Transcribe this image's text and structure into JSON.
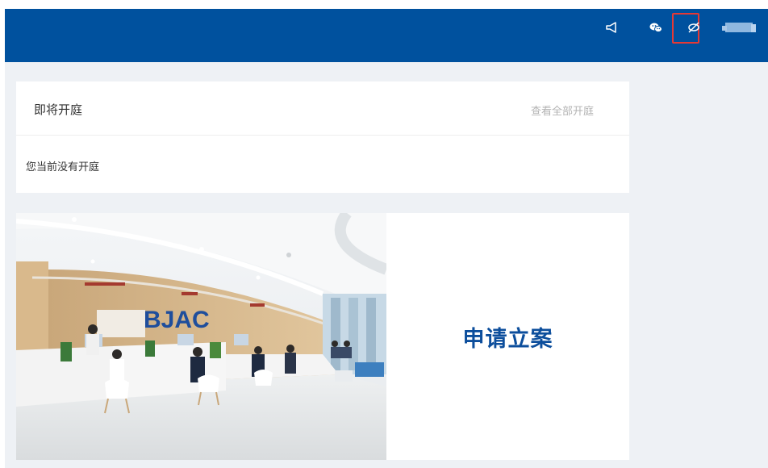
{
  "colors": {
    "header_bg": "#00519e",
    "page_bg": "#eef1f5",
    "highlight_border": "#e53935",
    "apply_text": "#0c4e9c"
  },
  "header": {
    "icons": [
      "notice-icon",
      "wechat-icon",
      "eye-off-icon",
      "user-avatar"
    ]
  },
  "court_card": {
    "title": "即将开庭",
    "view_all_link": "查看全部开庭",
    "empty_message": "您当前没有开庭"
  },
  "apply_card": {
    "label": "申请立案",
    "photo_sign_text": "BJAC"
  }
}
